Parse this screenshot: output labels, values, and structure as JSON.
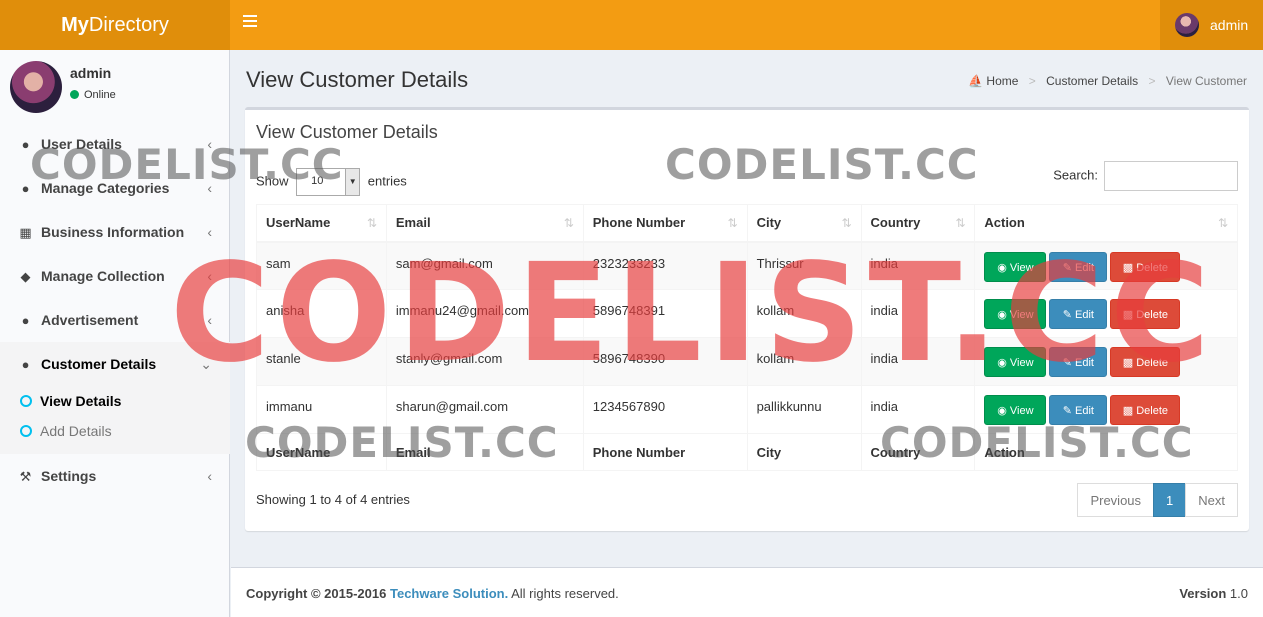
{
  "header": {
    "logo_bold": "My",
    "logo_rest": "Directory",
    "user_name": "admin"
  },
  "sidebar": {
    "user_name": "admin",
    "status": "Online",
    "menu": [
      {
        "label": "User Details",
        "icon": "user-icon"
      },
      {
        "label": "Manage Categories",
        "icon": "user-icon"
      },
      {
        "label": "Business Information",
        "icon": "building-icon"
      },
      {
        "label": "Manage Collection",
        "icon": "cube-icon"
      },
      {
        "label": "Advertisement",
        "icon": "user-icon"
      },
      {
        "label": "Customer Details",
        "icon": "users-icon"
      },
      {
        "label": "Settings",
        "icon": "wrench-icon"
      }
    ],
    "submenu": [
      {
        "label": "View Details"
      },
      {
        "label": "Add Details"
      }
    ]
  },
  "content": {
    "title": "View Customer Details",
    "breadcrumb": {
      "home": "Home",
      "parent": "Customer Details",
      "current": "View Customer"
    }
  },
  "box": {
    "title": "View Customer Details",
    "show_label": "Show",
    "page_size": "10",
    "entries_label": "entries",
    "search_label": "Search:",
    "search_value": "",
    "columns": [
      "UserName",
      "Email",
      "Phone Number",
      "City",
      "Country",
      "Action"
    ],
    "rows": [
      {
        "username": "sam",
        "email": "sam@gmail.com",
        "phone": "2323233233",
        "city": "Thrissur",
        "country": "india"
      },
      {
        "username": "anisha",
        "email": "immanu24@gmail.com",
        "phone": "5896748391",
        "city": "kollam",
        "country": "india"
      },
      {
        "username": "stanle",
        "email": "stanly@gmail.com",
        "phone": "5896748390",
        "city": "kollam",
        "country": "india"
      },
      {
        "username": "immanu",
        "email": "sharun@gmail.com",
        "phone": "1234567890",
        "city": "pallikkunnu",
        "country": "india"
      }
    ],
    "actions": {
      "view": "View",
      "edit": "Edit",
      "delete": "Delete"
    },
    "info": "Showing 1 to 4 of 4 entries",
    "pagination": {
      "previous": "Previous",
      "current": "1",
      "next": "Next"
    }
  },
  "footer": {
    "copyright": "Copyright © 2015-2016",
    "company": "Techware Solution.",
    "rights": "All rights reserved.",
    "version_label": "Version",
    "version": "1.0"
  },
  "watermark": "CODELIST.CC",
  "colors": {
    "header": "#f39c12",
    "view": "#00a65a",
    "edit": "#3c8dbc",
    "delete": "#dd4b39",
    "link": "#3c8dbc"
  }
}
